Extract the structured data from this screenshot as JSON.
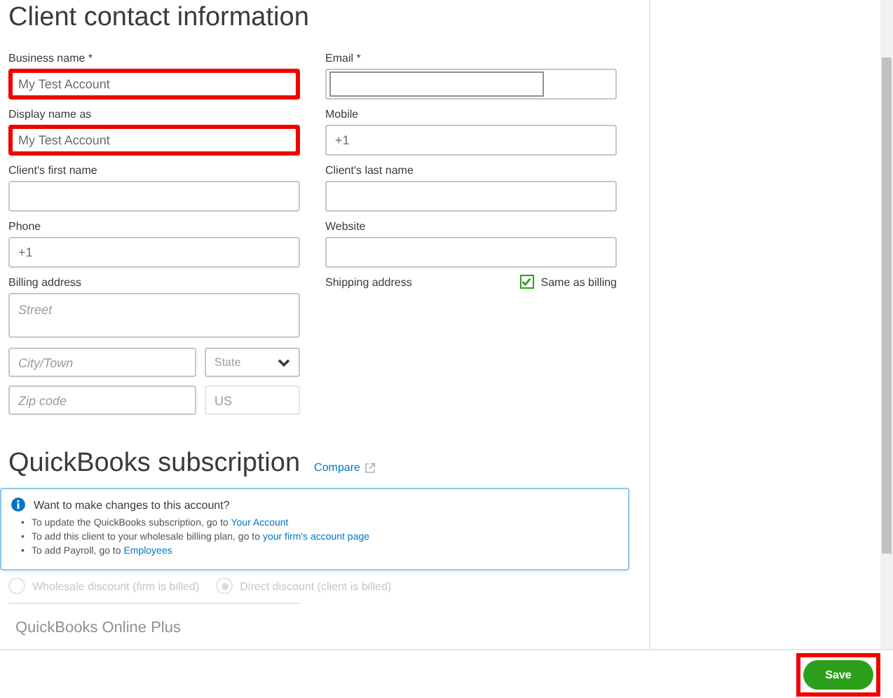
{
  "heading": "Client contact information",
  "fields": [
    {
      "label": "Business name *",
      "value": "My Test Account",
      "highlighted": true
    },
    {
      "label": "Email *",
      "autofill": true,
      "highlighted": false
    },
    {
      "label": "Display name as",
      "value": "My Test Account",
      "highlighted": true
    },
    {
      "label": "Mobile",
      "value": "+1",
      "highlighted": false
    },
    {
      "label": "Client's first name",
      "highlighted": false
    },
    {
      "label": "Client's last name",
      "highlighted": false
    },
    {
      "label": "Phone",
      "value": "+1",
      "highlighted": false
    },
    {
      "label": "Website",
      "highlighted": false
    }
  ],
  "billing": {
    "label": "Billing address",
    "street": {
      "placeholder": "Street"
    },
    "city": {
      "placeholder": "City/Town"
    },
    "state": {
      "placeholder": "State"
    },
    "zip": {
      "placeholder": "Zip code"
    },
    "country": {
      "placeholder": "US"
    }
  },
  "shipping": {
    "label": "Shipping address",
    "same_as_billing": {
      "label": "Same as billing",
      "checked": true
    }
  },
  "subscription": {
    "heading": "QuickBooks subscription",
    "compare_link": "Compare",
    "info": {
      "title": "Want to make changes to this account?",
      "items": [
        {
          "bullet": "•",
          "text": "To update the QuickBooks subscription, go to",
          "link": "Your Account"
        },
        {
          "bullet": "•",
          "text": "To add this client to your wholesale billing plan, go to",
          "link": "your firm's account page"
        },
        {
          "bullet": "•",
          "text": "To add Payroll, go to",
          "link": "Employees"
        }
      ]
    },
    "discounts": [
      {
        "label": "Wholesale discount (firm is billed)",
        "selected": false
      },
      {
        "label": "Direct discount (client is billed)",
        "selected": true
      }
    ],
    "plan": "QuickBooks Online Plus"
  },
  "save_button": {
    "label": "Save",
    "highlighted": true
  }
}
